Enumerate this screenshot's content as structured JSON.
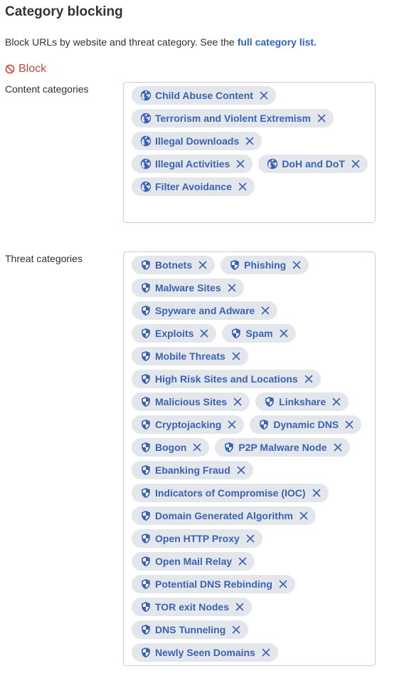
{
  "header": {
    "title": "Category blocking",
    "description": "Block URLs by website and threat category. See the",
    "link_text": "full category list."
  },
  "block": {
    "label": "Block",
    "icon": "block-icon",
    "color": "#c04a3c"
  },
  "content": {
    "label": "Content categories",
    "icon": "globe-icon",
    "chips": [
      "Child Abuse Content",
      "Terrorism and Violent Extremism",
      "Illegal Downloads",
      "Illegal Activities",
      "DoH and DoT",
      "Filter Avoidance"
    ]
  },
  "threat": {
    "label": "Threat categories",
    "icon": "shield-icon",
    "chips": [
      "Botnets",
      "Phishing",
      "Malware Sites",
      "Spyware and Adware",
      "Exploits",
      "Spam",
      "Mobile Threats",
      "High Risk Sites and Locations",
      "Malicious Sites",
      "Linkshare",
      "Cryptojacking",
      "Dynamic DNS",
      "Bogon",
      "P2P Malware Node",
      "Ebanking Fraud",
      "Indicators of Compromise (IOC)",
      "Domain Generated Algorithm",
      "Open HTTP Proxy",
      "Open Mail Relay",
      "Potential DNS Rebinding",
      "TOR exit Nodes",
      "DNS Tunneling",
      "Newly Seen Domains"
    ]
  },
  "colors": {
    "chip_bg": "#e3e6ea",
    "chip_text": "#3a63b6",
    "link": "#2f63c5",
    "border": "#c9cdd3"
  }
}
